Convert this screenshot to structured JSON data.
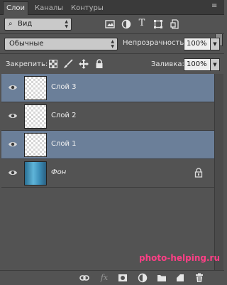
{
  "tabs": [
    {
      "label": "Слои",
      "active": true
    },
    {
      "label": "Каналы",
      "active": false
    },
    {
      "label": "Контуры",
      "active": false
    }
  ],
  "filter": {
    "label": "Вид"
  },
  "blend": {
    "mode": "Обычные",
    "opacity_label": "Непрозрачность:",
    "opacity_value": "100%"
  },
  "lock": {
    "label": "Закрепить:",
    "fill_label": "Заливка:",
    "fill_value": "100%"
  },
  "layers": [
    {
      "name": "Слой 3",
      "selected": true,
      "thumb": "transparent",
      "locked": false,
      "italic": false
    },
    {
      "name": "Слой 2",
      "selected": false,
      "thumb": "transparent",
      "locked": false,
      "italic": false
    },
    {
      "name": "Слой 1",
      "selected": true,
      "thumb": "transparent",
      "locked": false,
      "italic": false
    },
    {
      "name": "Фон",
      "selected": false,
      "thumb": "background",
      "locked": true,
      "italic": true
    }
  ],
  "watermark": "photo-helping.ru",
  "colors": {
    "selection": "#6b7f99",
    "watermark": "#ff3f86"
  }
}
